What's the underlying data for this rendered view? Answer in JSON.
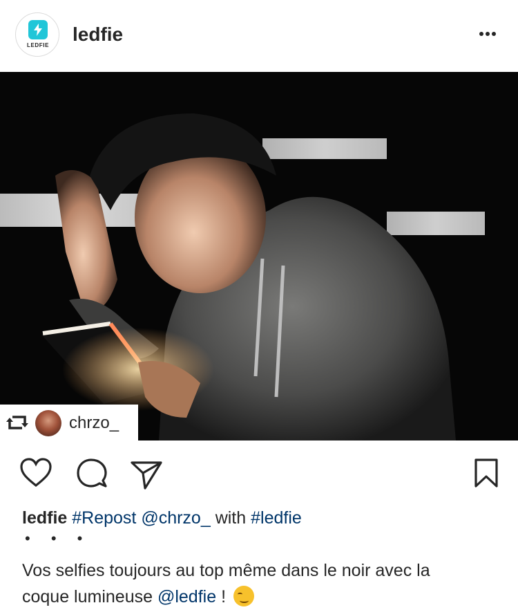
{
  "post": {
    "username": "ledfie",
    "avatar_brand": "LEDFIE",
    "more_icon": "ellipsis-icon"
  },
  "photo": {
    "alt": "photo",
    "repost_username": "chrzo_",
    "repost_icon": "repost-icon"
  },
  "actions": {
    "like_icon": "heart-icon",
    "comment_icon": "comment-icon",
    "share_icon": "send-icon",
    "save_icon": "bookmark-icon"
  },
  "caption": {
    "username": "ledfie",
    "hashtag_repost": "#Repost",
    "mention_chrzo": "@chrzo_",
    "word_with": "with",
    "hashtag_ledfie": "#ledfie",
    "dots": "• • •",
    "line1": "Vos selfies toujours au top même dans le noir avec la",
    "line2_start": "coque lumineuse",
    "mention_ledfie": "@ledfie",
    "line2_end": "!"
  },
  "colors": {
    "text": "#262626",
    "link": "#003569",
    "brand": "#20c6d8"
  }
}
